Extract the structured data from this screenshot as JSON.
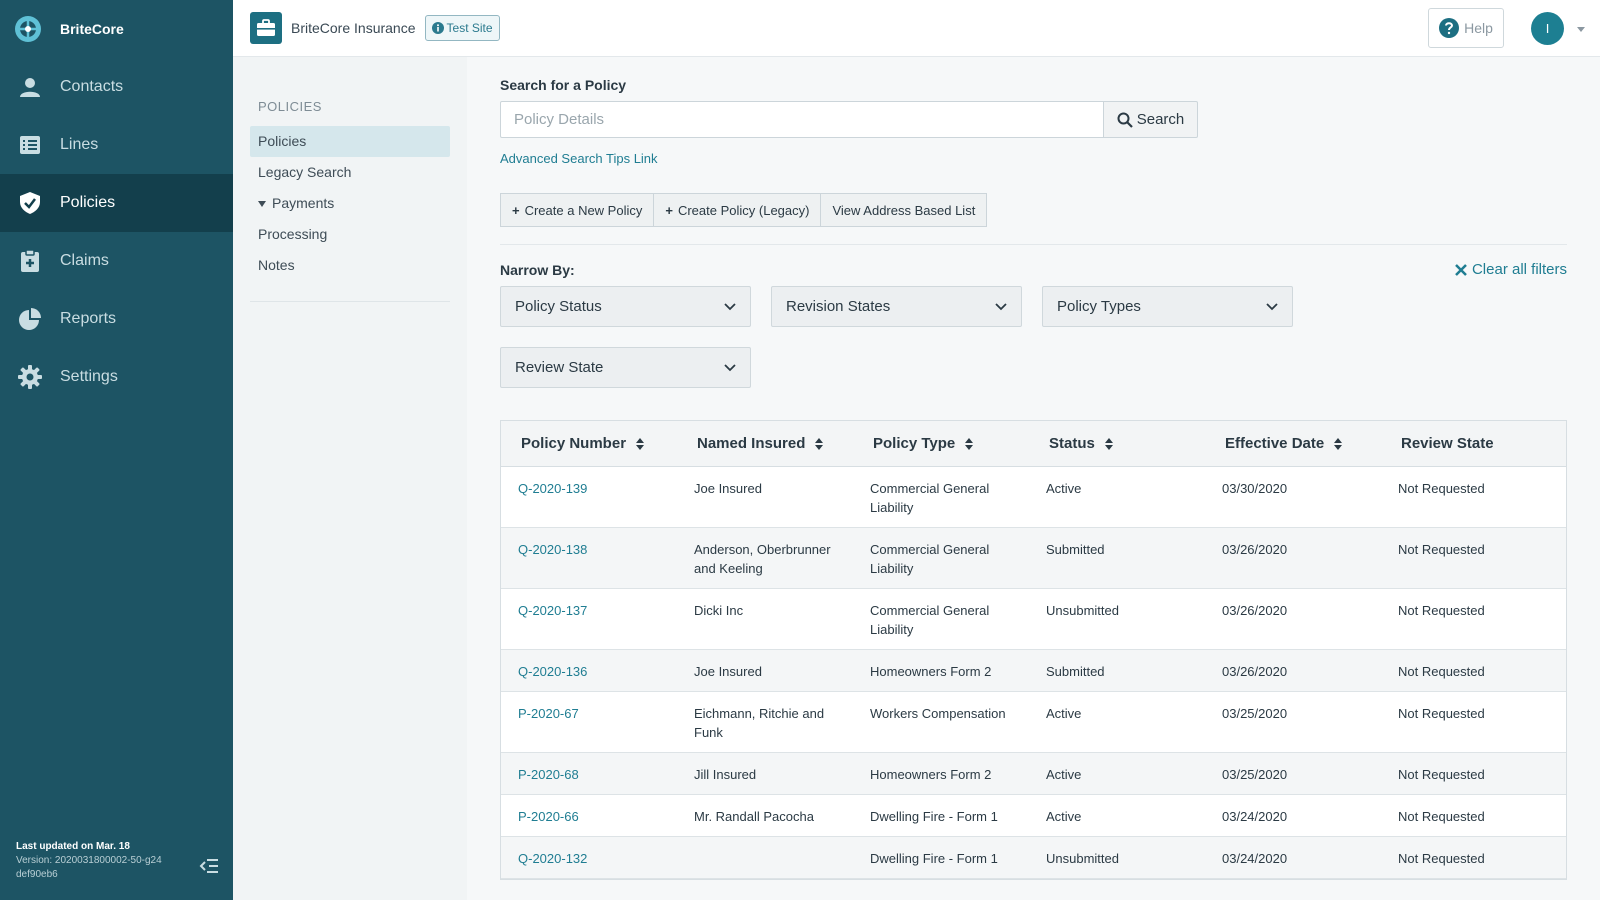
{
  "brand": {
    "name": "BriteCore"
  },
  "nav": {
    "items": [
      {
        "label": "Contacts",
        "icon": "person-icon"
      },
      {
        "label": "Lines",
        "icon": "list-icon"
      },
      {
        "label": "Policies",
        "icon": "shield-icon",
        "active": true
      },
      {
        "label": "Claims",
        "icon": "clipboard-icon"
      },
      {
        "label": "Reports",
        "icon": "pie-chart-icon"
      },
      {
        "label": "Settings",
        "icon": "gear-icon"
      }
    ],
    "footer": {
      "updated": "Last updated on Mar. 18",
      "version": "Version: 2020031800002-50-g24",
      "hash": "def90eb6"
    }
  },
  "topbar": {
    "company": "BriteCore Insurance",
    "site_badge": "Test Site",
    "help": "Help",
    "avatar_initial": "I"
  },
  "subnav": {
    "heading": "POLICIES",
    "items": [
      {
        "label": "Policies",
        "active": true
      },
      {
        "label": "Legacy Search"
      },
      {
        "label": "Payments",
        "expandable": true
      },
      {
        "label": "Processing"
      },
      {
        "label": "Notes"
      }
    ]
  },
  "search": {
    "title": "Search for a Policy",
    "placeholder": "Policy Details",
    "button": "Search",
    "tips_link": "Advanced Search Tips Link"
  },
  "actions": {
    "create_new": "Create a New Policy",
    "create_legacy": "Create Policy (Legacy)",
    "address_list": "View Address Based List"
  },
  "filters": {
    "narrow_by": "Narrow By:",
    "clear_all": "Clear all filters",
    "dropdowns": [
      "Policy Status",
      "Revision States",
      "Policy Types",
      "Review State"
    ]
  },
  "table": {
    "columns": [
      "Policy Number",
      "Named Insured",
      "Policy Type",
      "Status",
      "Effective Date",
      "Review State"
    ],
    "rows": [
      [
        "Q-2020-139",
        "Joe Insured",
        "Commercial General Liability",
        "Active",
        "03/30/2020",
        "Not Requested"
      ],
      [
        "Q-2020-138",
        "Anderson, Oberbrunner and Keeling",
        "Commercial General Liability",
        "Submitted",
        "03/26/2020",
        "Not Requested"
      ],
      [
        "Q-2020-137",
        "Dicki Inc",
        "Commercial General Liability",
        "Unsubmitted",
        "03/26/2020",
        "Not Requested"
      ],
      [
        "Q-2020-136",
        "Joe Insured",
        "Homeowners Form 2",
        "Submitted",
        "03/26/2020",
        "Not Requested"
      ],
      [
        "P-2020-67",
        "Eichmann, Ritchie and Funk",
        "Workers Compensation",
        "Active",
        "03/25/2020",
        "Not Requested"
      ],
      [
        "P-2020-68",
        "Jill Insured",
        "Homeowners Form 2",
        "Active",
        "03/25/2020",
        "Not Requested"
      ],
      [
        "P-2020-66",
        "Mr. Randall Pacocha",
        "Dwelling Fire - Form 1",
        "Active",
        "03/24/2020",
        "Not Requested"
      ],
      [
        "Q-2020-132",
        "",
        "Dwelling Fire - Form 1",
        "Unsubmitted",
        "03/24/2020",
        "Not Requested"
      ]
    ]
  },
  "colors": {
    "nav_bg": "#1d5464",
    "nav_active": "#133f4c",
    "accent": "#1f7d92"
  }
}
